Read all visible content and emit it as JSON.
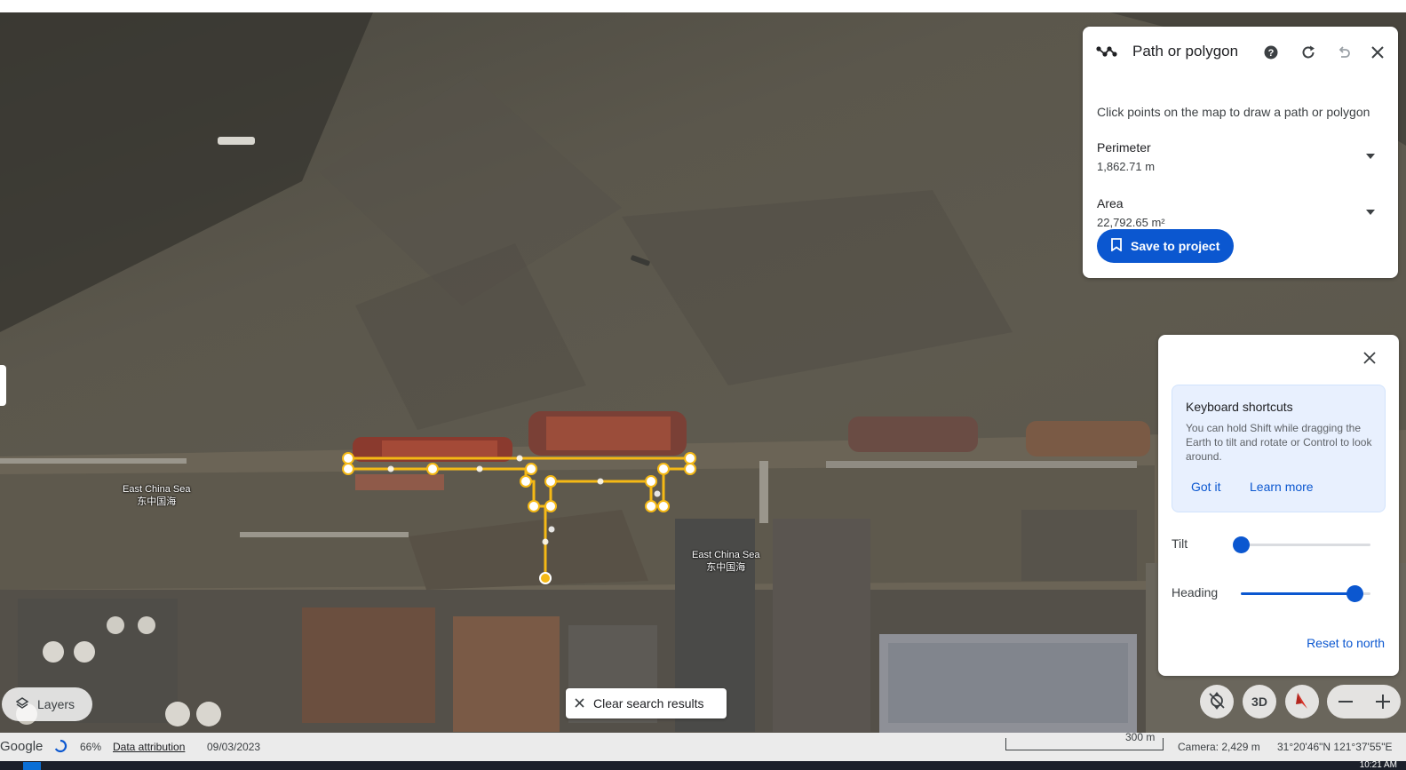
{
  "measure_panel": {
    "title": "Path or polygon",
    "description": "Click points on the map to draw a path or polygon",
    "perimeter": {
      "label": "Perimeter",
      "value": "1,862.71 m"
    },
    "area": {
      "label": "Area",
      "value": "22,792.65 m²"
    },
    "save_label": "Save to project"
  },
  "nav_panel": {
    "shortcuts_title": "Keyboard shortcuts",
    "shortcuts_text": "You can hold Shift while dragging the Earth to tilt and rotate or Control to look around.",
    "got_it": "Got it",
    "learn_more": "Learn more",
    "tilt_label": "Tilt",
    "tilt_value": 0,
    "heading_label": "Heading",
    "heading_value": 0.88,
    "reset_label": "Reset to north"
  },
  "map": {
    "labels": [
      {
        "line1": "East China Sea",
        "line2": "东中国海"
      },
      {
        "line1": "East China Sea",
        "line2": "东中国海"
      }
    ]
  },
  "controls": {
    "layers_label": "Layers",
    "clear_label": "Clear search results",
    "view_3d": "3D"
  },
  "status_bar": {
    "brand": "Google",
    "progress": "66%",
    "attribution": "Data attribution",
    "date": "09/03/2023",
    "scale": "300 m",
    "camera": "Camera: 2,429 m",
    "coords": "31°20'46\"N 121°37'55\"E"
  },
  "taskbar": {
    "time": "10:21 AM"
  },
  "colors": {
    "accent": "#0b57d0",
    "path": "#f5b915"
  }
}
